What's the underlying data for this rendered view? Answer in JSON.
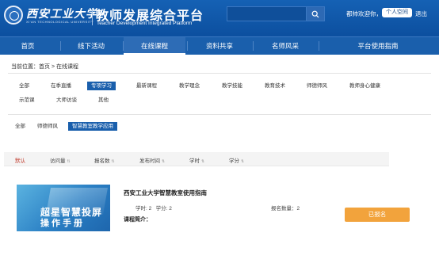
{
  "header": {
    "university_cn": "西安工业大学",
    "university_en": "XI'AN TECHNOLOGICAL UNIVERSITY",
    "site_title": "教师发展综合平台",
    "site_subtitle": "Teacher Development Integrated Platform",
    "welcome": "都帅欢迎你，",
    "personal_space": "个人空间",
    "logout": "退出",
    "search_placeholder": ""
  },
  "nav": {
    "items": [
      "首页",
      "线下活动",
      "在线课程",
      "资料共享",
      "名师风采",
      "平台使用指南"
    ],
    "active": "在线课程"
  },
  "breadcrumb": "当前位置：首页 > 在线课程",
  "categories": {
    "row1": [
      "全部",
      "在季直播",
      "专项学习",
      "最新课程",
      "教学理念",
      "教学技能",
      "教育技术",
      "师德师风",
      "教师身心健康"
    ],
    "row2": [
      "示范课",
      "大师访谈",
      "其他"
    ],
    "active": "专项学习"
  },
  "subcategories": {
    "items": [
      "全部",
      "师德师风",
      "智慧教室教学应用"
    ],
    "active": "智慧教室教学应用"
  },
  "sort": {
    "items": [
      "默认",
      "访问量",
      "报名数",
      "发布时间",
      "学时",
      "学分"
    ],
    "active": "默认"
  },
  "course": {
    "thumb_line1": "超星智慧投屏",
    "thumb_line2": "操作手册",
    "title": "西安工业大学智慧教室使用指南",
    "hours_label": "学时: 2",
    "credits_label": "学分: 2",
    "enroll_count_label": "报名数量：2",
    "intro_label": "课程简介：",
    "status_button": "已报名"
  },
  "colors": {
    "primary": "#1a5fac",
    "accent": "#f2a33c",
    "sort_active": "#c0392b"
  }
}
